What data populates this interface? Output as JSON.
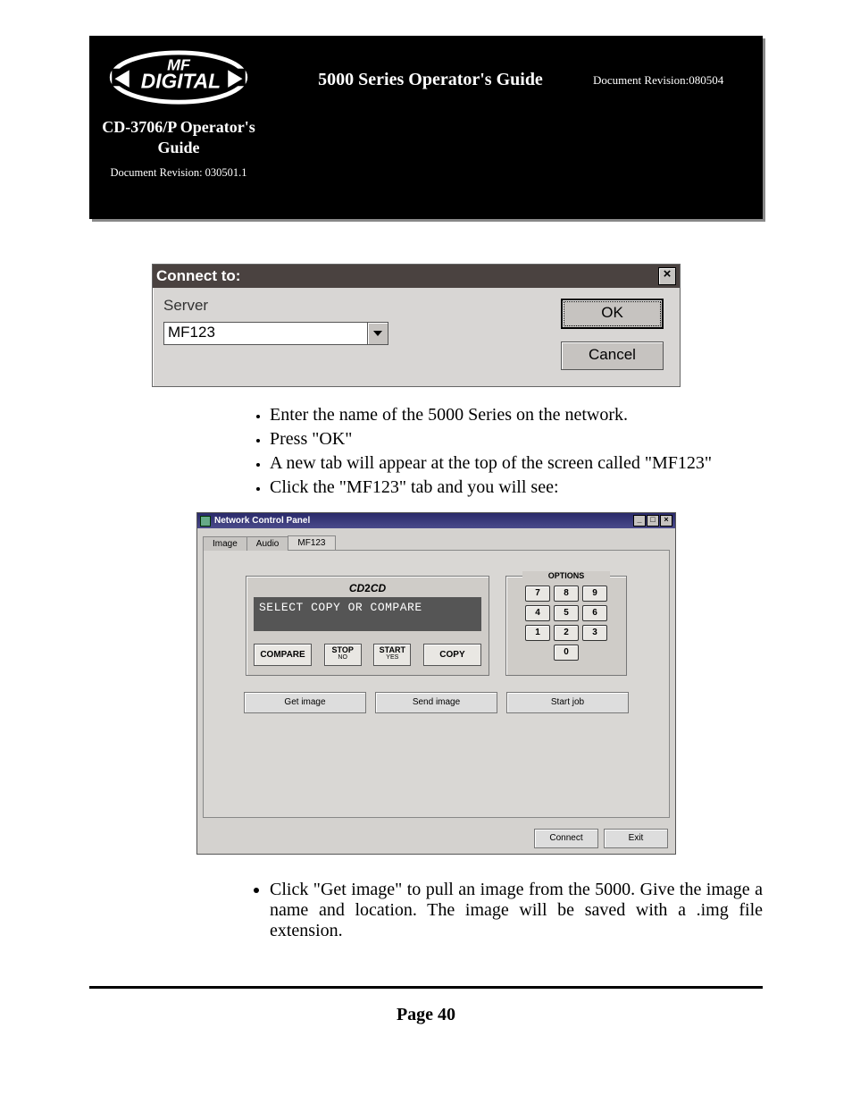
{
  "header": {
    "left_title": "CD-3706/P Operator's Guide",
    "left_rev": "Document Revision: 030501.1",
    "mid_title": "5000 Series Operator's Guide",
    "right_rev": "Document Revision:080504"
  },
  "dialog": {
    "title": "Connect to:",
    "server_label": "Server",
    "server_value": "MF123",
    "ok_label": "OK",
    "cancel_label": "Cancel"
  },
  "bullets1": [
    "Enter the name of the 5000 Series on the network.",
    "Press \"OK\"",
    "A new tab will appear at the top of the screen called \"MF123\"",
    "Click the \"MF123\" tab and you will see:"
  ],
  "ncp": {
    "window_title": "Network Control Panel",
    "tabs": [
      "Image",
      "Audio",
      "MF123"
    ],
    "lcd_brand": "CD2CD",
    "lcd_line1": "SELECT COPY OR COMPARE",
    "buttons": {
      "compare": "COMPARE",
      "stop": "STOP",
      "stop_sub": "NO",
      "start": "START",
      "start_sub": "YES",
      "copy": "COPY"
    },
    "options_title": "OPTIONS",
    "keypad": [
      "7",
      "8",
      "9",
      "4",
      "5",
      "6",
      "1",
      "2",
      "3",
      "0"
    ],
    "mid_buttons": [
      "Get image",
      "Send image",
      "Start job"
    ],
    "footer_buttons": [
      "Connect",
      "Exit"
    ]
  },
  "bullets2": "Click \"Get image\" to pull an image from the 5000. Give the image a name and location. The image will be saved with a .img file extension.",
  "page_num": "Page 40"
}
